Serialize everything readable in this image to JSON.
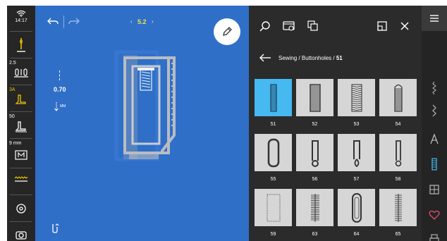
{
  "status": {
    "time": "14:17"
  },
  "left_bar": {
    "stitch_width_label": "2.5",
    "presser_foot_label": "3A",
    "tension_label": "50",
    "foot_height_label": "9 mm"
  },
  "stitch_area": {
    "width_value": "5.2",
    "length_value": "0.70",
    "length_unit": "MM",
    "width_prev": "‹",
    "width_next": "›"
  },
  "panel": {
    "breadcrumb": [
      "Sewing",
      "Buttonholes"
    ],
    "breadcrumb_current": "51",
    "breadcrumb_sep": " / ",
    "patterns": [
      {
        "number": "51",
        "selected": true,
        "style": "narrow-dense"
      },
      {
        "number": "52",
        "selected": false,
        "style": "wide-dense"
      },
      {
        "number": "53",
        "selected": false,
        "style": "wide-zigzag"
      },
      {
        "number": "54",
        "selected": false,
        "style": "round-end"
      },
      {
        "number": "55",
        "selected": false,
        "style": "rounded-wide"
      },
      {
        "number": "56",
        "selected": false,
        "style": "eyelet-round"
      },
      {
        "number": "57",
        "selected": false,
        "style": "eyelet-teardrop"
      },
      {
        "number": "58",
        "selected": false,
        "style": "eyelet-narrow"
      },
      {
        "number": "59",
        "selected": false,
        "style": "dotted-outline"
      },
      {
        "number": "63",
        "selected": false,
        "style": "ladder"
      },
      {
        "number": "64",
        "selected": false,
        "style": "oval-outline"
      },
      {
        "number": "65",
        "selected": false,
        "style": "ladder-loose"
      }
    ]
  },
  "colors": {
    "stitch_bg": "#2f6fc8",
    "panel_bg": "#2b2b2b",
    "selected_tile": "#45b9f0",
    "accent_yellow": "#f2e24a",
    "heart": "#e0506a"
  }
}
